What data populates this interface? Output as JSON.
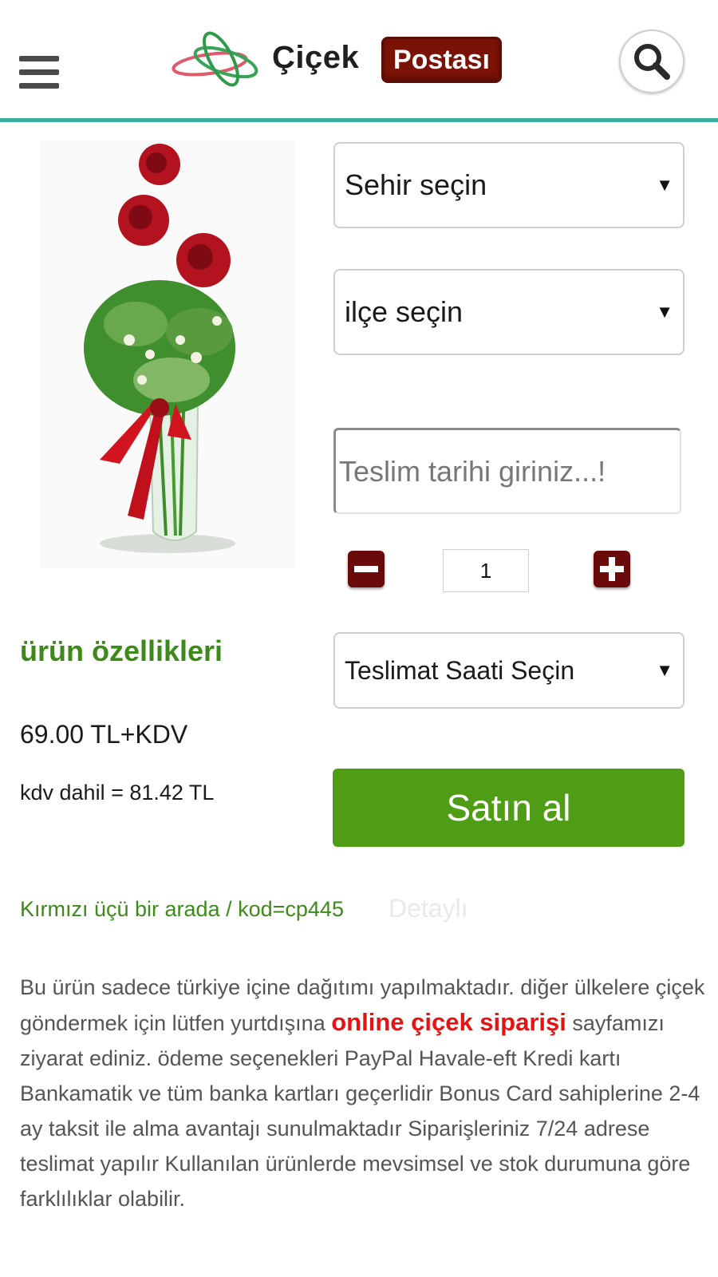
{
  "header": {
    "brand_word": "Çiçek",
    "brand_badge": "Postası"
  },
  "selects": {
    "city": "Sehir seçin",
    "district": "ilçe seçin",
    "delivery_time": "Teslimat Saati Seçin",
    "arrow": "▼"
  },
  "delivery_date": {
    "placeholder": "Teslim tarihi giriniz...!"
  },
  "quantity": {
    "value": "1"
  },
  "product": {
    "features_title": "ürün özellikleri",
    "price": "69.00 TL+KDV",
    "price_with_vat": "kdv dahil = 81.42 TL",
    "buy_label": "Satın al",
    "name_code": "Kırmızı üçü bir arada / kod=cp445",
    "detail_link": "Detaylı"
  },
  "description": {
    "part1": "Bu ürün sadece türkiye içine dağıtımı yapılmaktadır. diğer ülkelere çiçek göndermek için lütfen yurtdışına ",
    "link": "online çiçek siparişi",
    "part2": " sayfamızı ziyarat ediniz. ödeme seçenekleri PayPal Havale-eft Kredi kartı Bankamatik ve tüm banka kartları geçerlidir Bonus Card sahiplerine 2-4 ay taksit ile alma avantajı sunulmaktadır Siparişleriniz 7/24 adrese teslimat yapılır Kullanılan ürünlerde mevsimsel ve stok durumuna göre farklılıklar olabilir."
  },
  "colors": {
    "accent_line": "#3aaea0",
    "brand_badge": "#7a1206",
    "buy_button": "#4f9d14",
    "features_green": "#3d8a1b",
    "link_red": "#e41414",
    "qty_buttons": "#6b0a0a"
  },
  "icons": {
    "menu": "hamburger-menu-icon",
    "search": "search-icon",
    "logo": "flower-ribbon-logo-icon",
    "minus": "minus-icon",
    "plus": "plus-icon"
  }
}
